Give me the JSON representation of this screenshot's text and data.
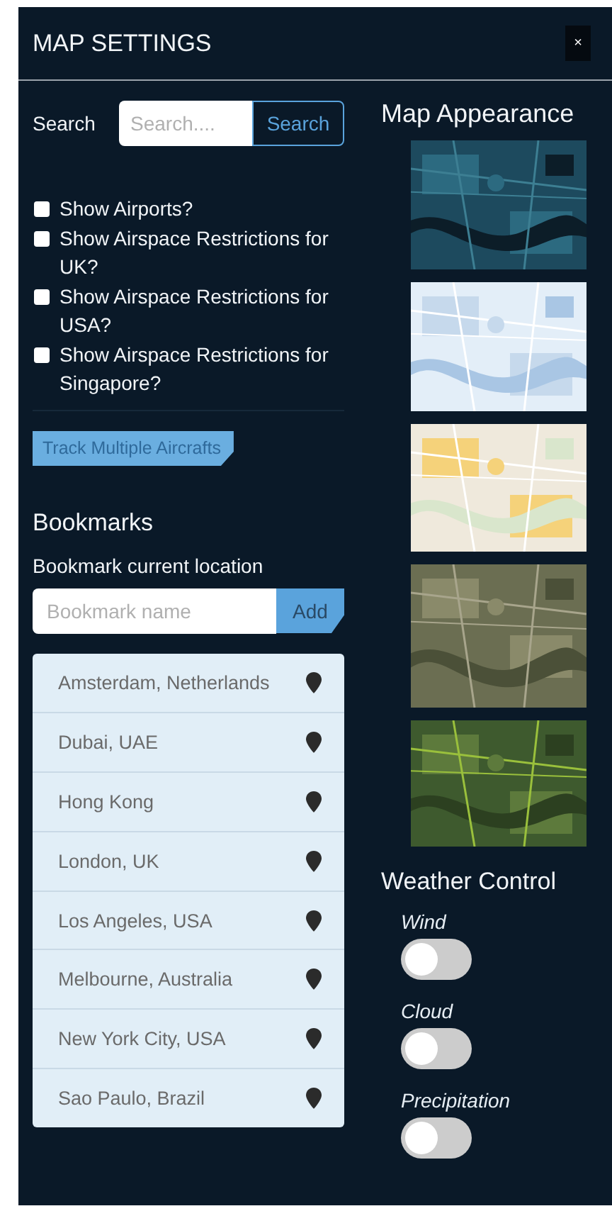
{
  "title": "MAP SETTINGS",
  "close": "×",
  "search": {
    "label": "Search",
    "placeholder": "Search....",
    "button": "Search"
  },
  "options": [
    {
      "label": "Show Airports?",
      "checked": false
    },
    {
      "label": "Show Airspace Restrictions for UK?",
      "checked": false
    },
    {
      "label": "Show Airspace Restrictions for USA?",
      "checked": false
    },
    {
      "label": "Show Airspace Restrictions for Singapore?",
      "checked": false
    }
  ],
  "track_button": "Track Multiple Aircrafts",
  "bookmarks": {
    "title": "Bookmarks",
    "label": "Bookmark current location",
    "placeholder": "Bookmark name",
    "button": "Add",
    "items": [
      {
        "name": "Amsterdam, Netherlands"
      },
      {
        "name": "Dubai, UAE"
      },
      {
        "name": "Hong Kong"
      },
      {
        "name": "London, UK"
      },
      {
        "name": "Los Angeles, USA"
      },
      {
        "name": "Melbourne, Australia"
      },
      {
        "name": "New York City, USA"
      },
      {
        "name": "Sao Paulo, Brazil"
      }
    ]
  },
  "map_appearance": {
    "title": "Map Appearance"
  },
  "weather": {
    "title": "Weather Control",
    "toggles": [
      {
        "label": "Wind",
        "on": false
      },
      {
        "label": "Cloud",
        "on": false
      },
      {
        "label": "Precipitation",
        "on": false
      }
    ]
  }
}
